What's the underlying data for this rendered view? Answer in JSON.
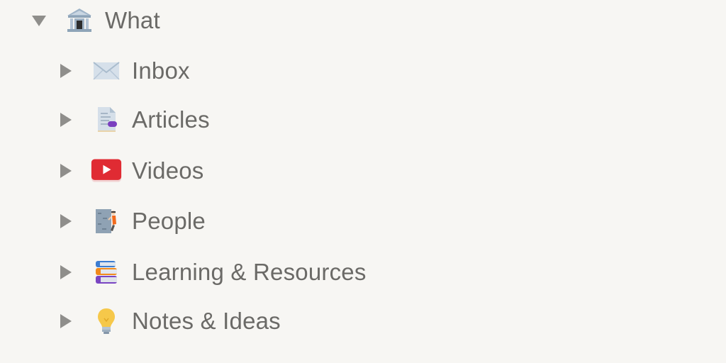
{
  "sidebar": {
    "root": {
      "label": "What",
      "icon": "classical-building-icon",
      "expanded": true
    },
    "children": [
      {
        "label": "Inbox",
        "icon": "envelope-icon",
        "expanded": false
      },
      {
        "label": "Articles",
        "icon": "page-facing-up-icon",
        "expanded": false
      },
      {
        "label": "Videos",
        "icon": "youtube-play-icon",
        "expanded": false
      },
      {
        "label": "People",
        "icon": "person-climbing-icon",
        "expanded": false
      },
      {
        "label": "Learning & Resources",
        "icon": "books-icon",
        "expanded": false
      },
      {
        "label": "Notes & Ideas",
        "icon": "light-bulb-icon",
        "expanded": false
      }
    ]
  },
  "colors": {
    "background": "#f7f6f3",
    "text": "#6b6a67",
    "toggle": "#8f8e8b"
  }
}
